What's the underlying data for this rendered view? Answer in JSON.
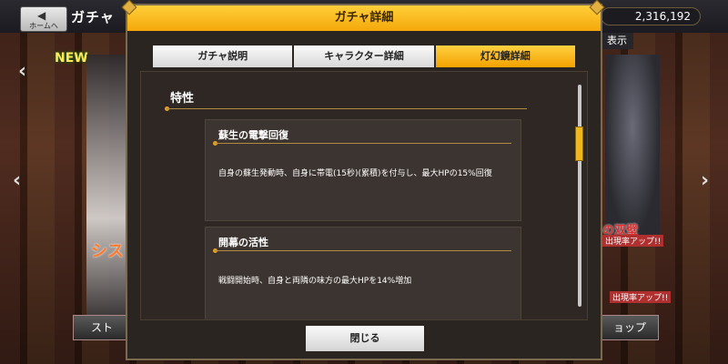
{
  "background": {
    "home_button_label": "ホームへ",
    "screen_title": "ガチャ",
    "currency_amount": "2,316,192",
    "display_button_label": "表示",
    "new_badge": "NEW",
    "promo_left": "シス",
    "promo_right": "の双璧",
    "promo_right_sub": "出現率アップ!!",
    "promo_right_sub2": "出現率アップ!!",
    "bottom_left_button": "スト",
    "bottom_right_button": "ョップ"
  },
  "modal": {
    "title": "ガチャ詳細",
    "tabs": [
      {
        "label": "ガチャ説明",
        "active": false
      },
      {
        "label": "キャラクター詳細",
        "active": false
      },
      {
        "label": "灯幻鏡詳細",
        "active": true
      }
    ],
    "section_title": "特性",
    "traits": [
      {
        "name": "蘇生の電撃回復",
        "description": "自身の蘇生発動時、自身に帯電(15秒)(累積)を付与し、最大HPの15%回復"
      },
      {
        "name": "開幕の活性",
        "description": "戦闘開始時、自身と両隣の味方の最大HPを14%増加"
      }
    ],
    "close_button": "閉じる",
    "scroll_position": 0.2
  },
  "colors": {
    "header_gold": "#f4a80a",
    "active_tab": "#ffd040",
    "accent_line": "#b08a40",
    "panel_bg": "#2e2723"
  }
}
